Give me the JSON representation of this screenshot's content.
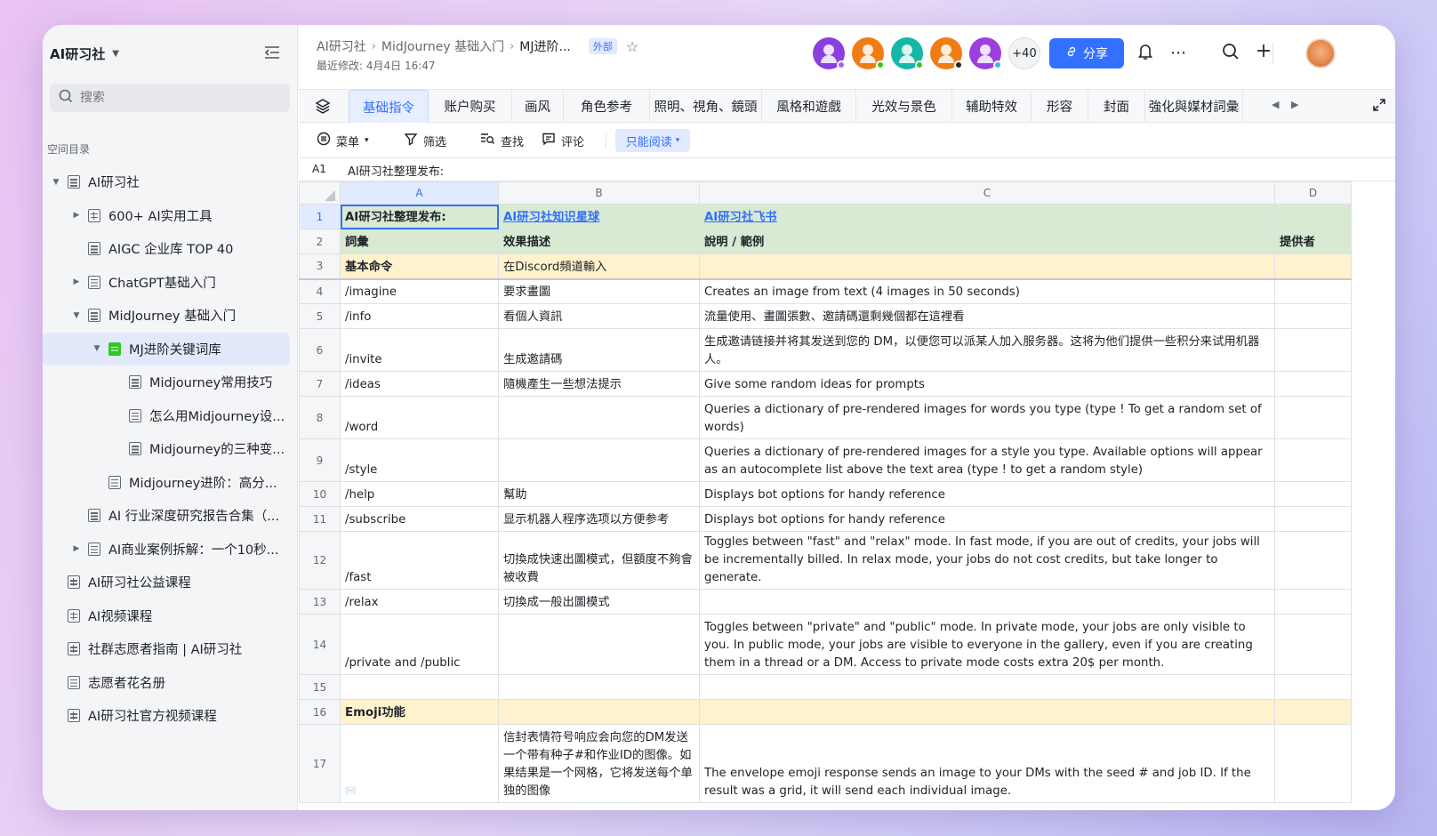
{
  "sidebar": {
    "workspace_title": "AI研习社",
    "search_placeholder": "搜索",
    "section_label": "空间目录",
    "items": [
      {
        "label": "AI研习社",
        "indent": 0,
        "arrow": "▼",
        "icon": "doc"
      },
      {
        "label": "600+ AI实用工具",
        "indent": 1,
        "arrow": "▶",
        "icon": "grid"
      },
      {
        "label": "AIGC 企业库 TOP 40",
        "indent": 1,
        "arrow": "",
        "icon": "doc"
      },
      {
        "label": "ChatGPT基础入门",
        "indent": 1,
        "arrow": "▶",
        "icon": "doc"
      },
      {
        "label": "MidJourney 基础入门",
        "indent": 1,
        "arrow": "▼",
        "icon": "doc"
      },
      {
        "label": "MJ进阶关键词库",
        "indent": 2,
        "arrow": "▼",
        "icon": "sheet",
        "active": true
      },
      {
        "label": "Midjourney常用技巧",
        "indent": 3,
        "arrow": "",
        "icon": "doc"
      },
      {
        "label": "怎么用Midjourney设...",
        "indent": 3,
        "arrow": "",
        "icon": "doc"
      },
      {
        "label": "Midjourney的三种变...",
        "indent": 3,
        "arrow": "",
        "icon": "doc"
      },
      {
        "label": "Midjourney进阶：高分...",
        "indent": 2,
        "arrow": "",
        "icon": "doc"
      },
      {
        "label": "AI 行业深度研究报告合集（...",
        "indent": 1,
        "arrow": "",
        "icon": "doc"
      },
      {
        "label": "AI商业案例拆解：一个10秒...",
        "indent": 1,
        "arrow": "▶",
        "icon": "doc"
      },
      {
        "label": "AI研习社公益课程",
        "indent": 0,
        "arrow": "",
        "icon": "grid"
      },
      {
        "label": "AI视频课程",
        "indent": 0,
        "arrow": "",
        "icon": "grid"
      },
      {
        "label": "社群志愿者指南 | AI研习社",
        "indent": 0,
        "arrow": "",
        "icon": "grid"
      },
      {
        "label": "志愿者花名册",
        "indent": 0,
        "arrow": "",
        "icon": "doc"
      },
      {
        "label": "AI研习社官方视频课程",
        "indent": 0,
        "arrow": "",
        "icon": "grid"
      }
    ]
  },
  "header": {
    "breadcrumb": [
      "AI研习社",
      "MidJourney 基础入门",
      "MJ进阶..."
    ],
    "external_badge": "外部",
    "last_modified": "最近修改: 4月4日 16:47",
    "avatars": [
      {
        "color": "#8b3fe0",
        "dot": "#9b6be8"
      },
      {
        "color": "#f07d14",
        "dot": "#34c724"
      },
      {
        "color": "#14b8a6",
        "dot": "#34c724"
      },
      {
        "color": "#f07d14",
        "dot": "#1f2329"
      },
      {
        "color": "#9b3fe0",
        "dot": "#3fb6e8"
      }
    ],
    "avatar_more": "+40",
    "share_label": "分享"
  },
  "tabs": [
    "基础指令",
    "账户购买",
    "画风",
    "角色参考",
    "照明、視角、鏡頭",
    "風格和遊戲",
    "光效与景色",
    "辅助特效",
    "形容",
    "封面",
    "強化與媒材詞彙"
  ],
  "toolbar": {
    "menu": "菜单",
    "filter": "筛选",
    "find": "查找",
    "comment": "评论",
    "readonly": "只能阅读"
  },
  "formula": {
    "cell": "A1",
    "value": "AI研习社整理发布:"
  },
  "columns": [
    "A",
    "B",
    "C",
    "D"
  ],
  "rows": [
    {
      "n": "1",
      "a": "AI研习社整理发布:",
      "b": "AI研习社知识星球",
      "c": "AI研习社飞书",
      "d": ""
    },
    {
      "n": "2",
      "a": "詞彙",
      "b": "效果描述",
      "c": "說明 / 範例",
      "d": "提供者"
    },
    {
      "n": "3",
      "a": "基本命令",
      "b": "在Discord頻道輸入",
      "c": "",
      "d": ""
    },
    {
      "n": "4",
      "a": "/imagine",
      "b": "要求畫圖",
      "c": "Creates an image from text (4 images in 50 seconds)",
      "d": ""
    },
    {
      "n": "5",
      "a": "/info",
      "b": "看個人資訊",
      "c": "流量使用、畫圖張數、邀請碼還剩幾個都在這裡看",
      "d": ""
    },
    {
      "n": "6",
      "a": "/invite",
      "b": "生成邀請碼",
      "c": "生成邀请链接并将其发送到您的 DM，以便您可以派某人加入服务器。这将为他们提供一些积分来试用机器人。",
      "d": ""
    },
    {
      "n": "7",
      "a": "/ideas",
      "b": "隨機產生一些想法提示",
      "c": "Give some random ideas for prompts",
      "d": ""
    },
    {
      "n": "8",
      "a": "/word",
      "b": "",
      "c": "Queries a dictionary of pre-rendered images for words you type (type ! To get a random set of words)",
      "d": ""
    },
    {
      "n": "9",
      "a": "/style",
      "b": "",
      "c": "Queries a dictionary of pre-rendered images for a style you type. Available options will appear as an autocomplete list above the text area (type ! to get a random style)",
      "d": ""
    },
    {
      "n": "10",
      "a": "/help",
      "b": "幫助",
      "c": "Displays bot options for handy reference",
      "d": ""
    },
    {
      "n": "11",
      "a": "/subscribe",
      "b": "显示机器人程序选项以方便参考",
      "c": "Displays bot options for handy reference",
      "d": ""
    },
    {
      "n": "12",
      "a": "/fast",
      "b": "切換成快速出圖模式，但額度不夠會被收費",
      "c": "Toggles between \"fast\" and \"relax\" mode. In fast mode, if you are out of credits, your jobs will be incrementally billed. In relax mode, your jobs do not cost credits, but take longer to generate.",
      "d": ""
    },
    {
      "n": "13",
      "a": "/relax",
      "b": "切換成一般出圖模式",
      "c": "",
      "d": ""
    },
    {
      "n": "14",
      "a": "/private and /public",
      "b": "",
      "c": "Toggles between \"private\" and \"public\" mode. In private mode, your jobs are only visible to you. In public mode, your jobs are visible to everyone in the gallery, even if you are creating them in a thread or a DM. Access to private mode costs extra 20$ per month.",
      "d": ""
    },
    {
      "n": "15",
      "a": "",
      "b": "",
      "c": "",
      "d": ""
    },
    {
      "n": "16",
      "a": "Emoji功能",
      "b": "",
      "c": "",
      "d": ""
    },
    {
      "n": "17",
      "a": "✉️",
      "b": "信封表情符号响应会向您的DM发送一个带有种子#和作业ID的图像。如果结果是一个网格，它将发送每个单独的图像",
      "c": "The envelope emoji response sends an image to your DMs with the seed # and job ID. If the result was a grid, it will send each individual image.",
      "d": ""
    }
  ]
}
